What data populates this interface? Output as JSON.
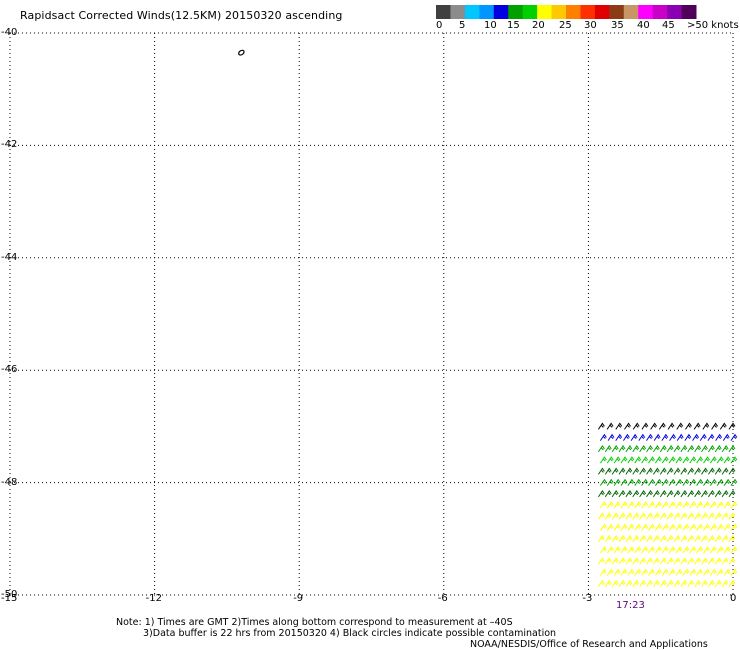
{
  "header": {
    "title": "Rapidsact Corrected Winds(12.5KM) 20150320 ascending"
  },
  "colorbar": {
    "colors": [
      "#404040",
      "#8c8c8c",
      "#00c8ff",
      "#0096ff",
      "#0000e0",
      "#00a000",
      "#00d000",
      "#ffff00",
      "#ffc800",
      "#ff8000",
      "#ff3000",
      "#e00000",
      "#8c3c14",
      "#c89664",
      "#ff00ff",
      "#c800c8",
      "#8c00b4",
      "#50005a"
    ],
    "labels": [
      "0",
      "5",
      "10",
      "15",
      "20",
      "25",
      "30",
      "35",
      "40",
      "45",
      ">50 knots"
    ]
  },
  "y_axis": {
    "ticks": [
      "-40",
      "-42",
      "-44",
      "-46",
      "-48",
      "-50"
    ]
  },
  "x_axis": {
    "ticks": [
      "-15",
      "-12",
      "-9",
      "-6",
      "-3",
      "0"
    ]
  },
  "time_label": "17:23",
  "notes": {
    "line1": "Note: 1) Times are GMT 2)Times along bottom correspond to measurement at –40S",
    "line2": "3)Data buffer is 22 hrs from 20150320 4) Black circles indicate possible contamination",
    "line3": "NOAA/NESDIS/Office of Research and Applications"
  },
  "wind_data": {
    "rows": [
      {
        "lat": -47.0,
        "color": "#000000",
        "count": 16
      },
      {
        "lat": -47.2,
        "color": "#0000e0",
        "count": 18
      },
      {
        "lat": -47.4,
        "color": "#00a000",
        "count": 20
      },
      {
        "lat": -47.6,
        "color": "#00d000",
        "count": 20
      },
      {
        "lat": -47.8,
        "color": "#006400",
        "count": 20
      },
      {
        "lat": -48.0,
        "color": "#00a000",
        "count": 20
      },
      {
        "lat": -48.2,
        "color": "#006400",
        "count": 20
      },
      {
        "lat": -48.4,
        "color": "#ffff00",
        "count": 20
      },
      {
        "lat": -48.6,
        "color": "#ffff00",
        "count": 20
      },
      {
        "lat": -48.8,
        "color": "#ffff00",
        "count": 20
      },
      {
        "lat": -49.0,
        "color": "#ffff00",
        "count": 20
      },
      {
        "lat": -49.2,
        "color": "#ffff00",
        "count": 20
      },
      {
        "lat": -49.4,
        "color": "#ffff00",
        "count": 20
      },
      {
        "lat": -49.6,
        "color": "#ffff00",
        "count": 20
      },
      {
        "lat": -49.8,
        "color": "#ffff00",
        "count": 20
      }
    ],
    "lon_start": -3,
    "lon_end": 0
  },
  "contamination_marker": {
    "lat": -40.35,
    "lon": -10.2
  }
}
